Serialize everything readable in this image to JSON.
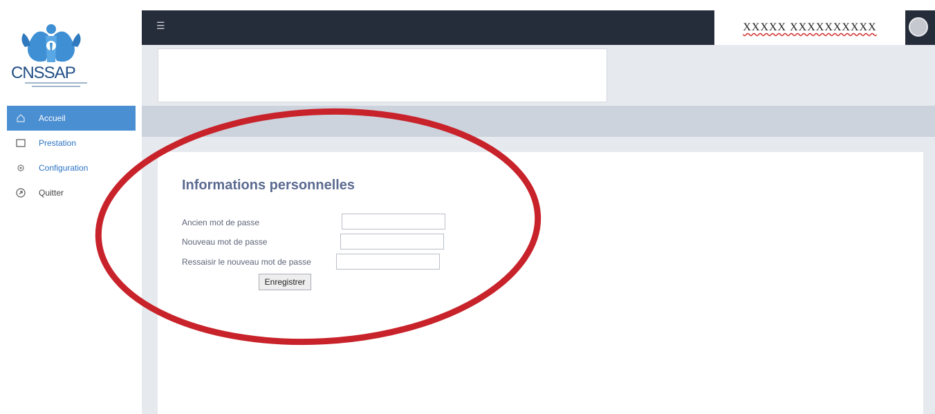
{
  "logo": {
    "text": "CNSSAP"
  },
  "sidebar": {
    "items": [
      {
        "label": "Accueil",
        "icon": "home-icon",
        "active": true
      },
      {
        "label": "Prestation",
        "icon": "folder-icon",
        "active": false
      },
      {
        "label": "Configuration",
        "icon": "gear-icon",
        "active": false
      },
      {
        "label": "Quitter",
        "icon": "exit-icon",
        "active": false
      }
    ]
  },
  "topbar": {
    "menu_icon": "hamburger-icon",
    "user_name": "XXXXX XXXXXXXXXX"
  },
  "form": {
    "title": "Informations personnelles",
    "old_password_label": "Ancien mot de passe",
    "new_password_label": "Nouveau mot de passe",
    "confirm_password_label": "Ressaisir le nouveau mot de passe",
    "old_password_value": "",
    "new_password_value": "",
    "confirm_password_value": "",
    "save_label": "Enregistrer"
  },
  "colors": {
    "accent": "#4a8fd2",
    "topbar": "#262d3a",
    "annotation": "#c8222a"
  }
}
